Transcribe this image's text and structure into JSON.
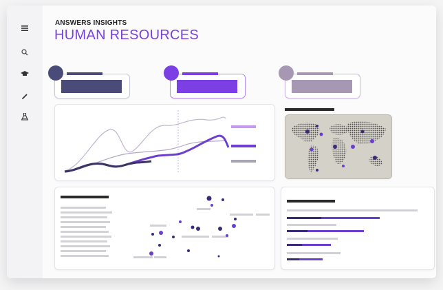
{
  "header": {
    "eyebrow": "ANSWERS INSIGHTS",
    "title": "HUMAN RESOURCES"
  },
  "sidebar": {
    "items": [
      {
        "icon": "menu-icon"
      },
      {
        "icon": "search-icon"
      },
      {
        "icon": "graduation-cap-icon"
      },
      {
        "icon": "pen-icon"
      },
      {
        "icon": "flask-icon"
      }
    ]
  },
  "kpis": [
    {
      "color": "#4b4b7a",
      "accent": "#4b4b7a"
    },
    {
      "color": "#7b3fe4",
      "accent": "#7b3fe4"
    },
    {
      "color": "#a698b3",
      "accent": "#a698b3"
    }
  ],
  "colors": {
    "purple": "#7b3fe4",
    "dark": "#3b3564",
    "lavender": "#b89ae6",
    "muted": "#a9a3b6",
    "map_bg": "#d4d1c9",
    "map_dots": "#555555"
  }
}
